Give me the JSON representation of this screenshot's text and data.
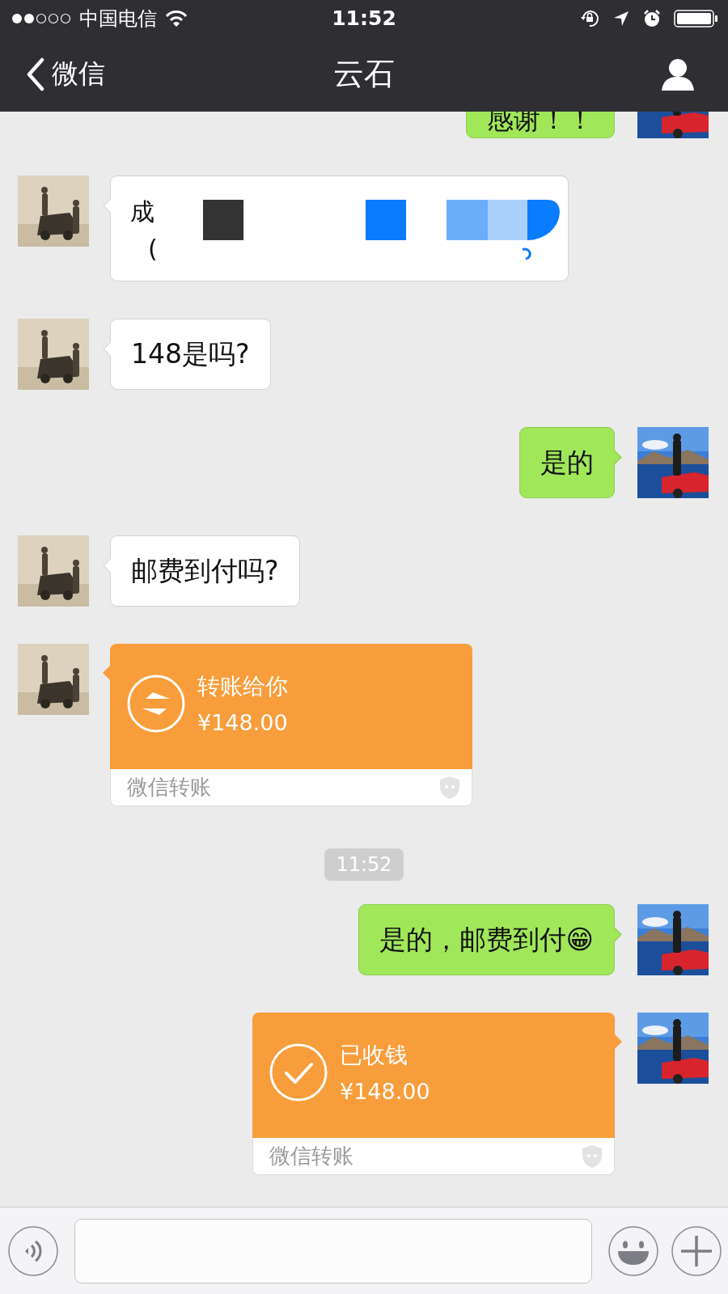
{
  "status_bar": {
    "carrier": "中国电信",
    "time": "11:52"
  },
  "nav": {
    "back_label": "微信",
    "title": "云石"
  },
  "messages": [
    {
      "kind": "text",
      "outgoing": true,
      "text": "感谢！！"
    },
    {
      "kind": "redacted",
      "outgoing": false,
      "fragments": [
        "成",
        "("
      ]
    },
    {
      "kind": "text",
      "outgoing": false,
      "text": "148是吗?"
    },
    {
      "kind": "text",
      "outgoing": true,
      "text": "是的"
    },
    {
      "kind": "text",
      "outgoing": false,
      "text": "邮费到付吗?"
    },
    {
      "kind": "transfer",
      "outgoing": false,
      "received": false,
      "title": "转账给你",
      "amount": "¥148.00",
      "footer": "微信转账"
    },
    {
      "kind": "time",
      "text": "11:52"
    },
    {
      "kind": "text",
      "outgoing": true,
      "text": "是的，邮费到付😁"
    },
    {
      "kind": "transfer",
      "outgoing": true,
      "received": true,
      "title": "已收钱",
      "amount": "¥148.00",
      "footer": "微信转账"
    }
  ]
}
